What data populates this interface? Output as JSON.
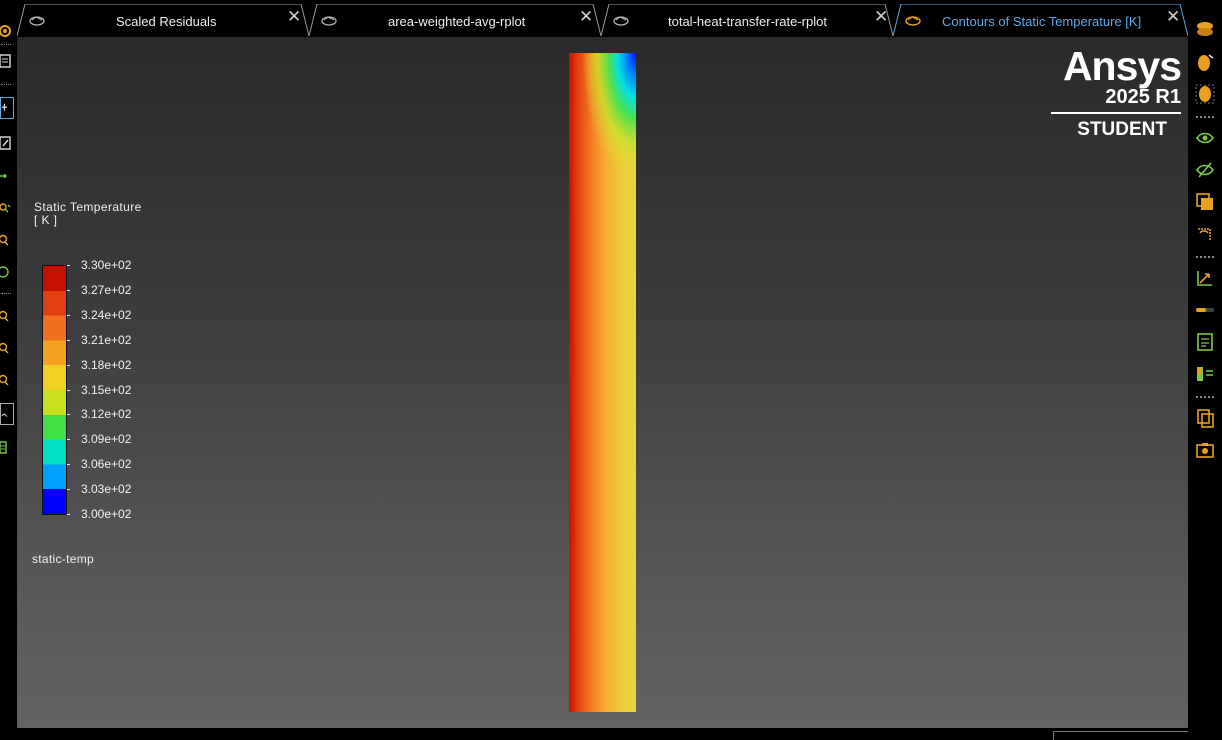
{
  "tabs": [
    {
      "label": "Scaled Residuals",
      "icon": "plot-icon",
      "active": false
    },
    {
      "label": "area-weighted-avg-rplot",
      "icon": "plot-icon",
      "active": false
    },
    {
      "label": "total-heat-transfer-rate-rplot",
      "icon": "plot-icon",
      "active": false
    },
    {
      "label": "Contours of Static Temperature [K]",
      "icon": "contour-icon",
      "active": true
    }
  ],
  "tab_close_symbol": "✕",
  "legend": {
    "title": "Static Temperature",
    "unit": "[ K ]",
    "ticks": [
      "3.30e+02",
      "3.27e+02",
      "3.24e+02",
      "3.21e+02",
      "3.18e+02",
      "3.15e+02",
      "3.12e+02",
      "3.09e+02",
      "3.06e+02",
      "3.03e+02",
      "3.00e+02"
    ],
    "min": 300,
    "max": 330,
    "colormap": [
      "#0000ff",
      "#00a0ff",
      "#00e0c0",
      "#40e040",
      "#c8e020",
      "#f0d020",
      "#f5a020",
      "#f07020",
      "#e04010",
      "#c81000"
    ]
  },
  "plot_name": "static-temp",
  "logo": {
    "brand": "Ansys",
    "version": "2025 R1",
    "edition": "STUDENT"
  },
  "colors": {
    "active_tab_text": "#5fa8e6",
    "toolbar_icon": "#e8a020",
    "toolbar_icon_green": "#7ac943",
    "viewport_top": "#2a2a2a",
    "viewport_bottom": "#636363"
  },
  "right_toolbar": [
    "layers-icon",
    "light-icon",
    "lighting-icon",
    "show-icon",
    "hide-icon",
    "view-icon",
    "undo-view-icon",
    "axes-icon",
    "slider-icon",
    "report-icon",
    "legend-icon",
    "copy-icon",
    "screenshot-icon"
  ],
  "left_toolbar": [
    "gear-icon",
    "select-icon",
    "pointer-icon",
    "rotate-icon",
    "pan-icon",
    "zoom-icon",
    "zoom-box-icon",
    "rotate-view-icon",
    "zoom-in-icon",
    "zoom-out-icon",
    "zoom-fit-icon",
    "probe-icon",
    "clipboard-icon"
  ]
}
